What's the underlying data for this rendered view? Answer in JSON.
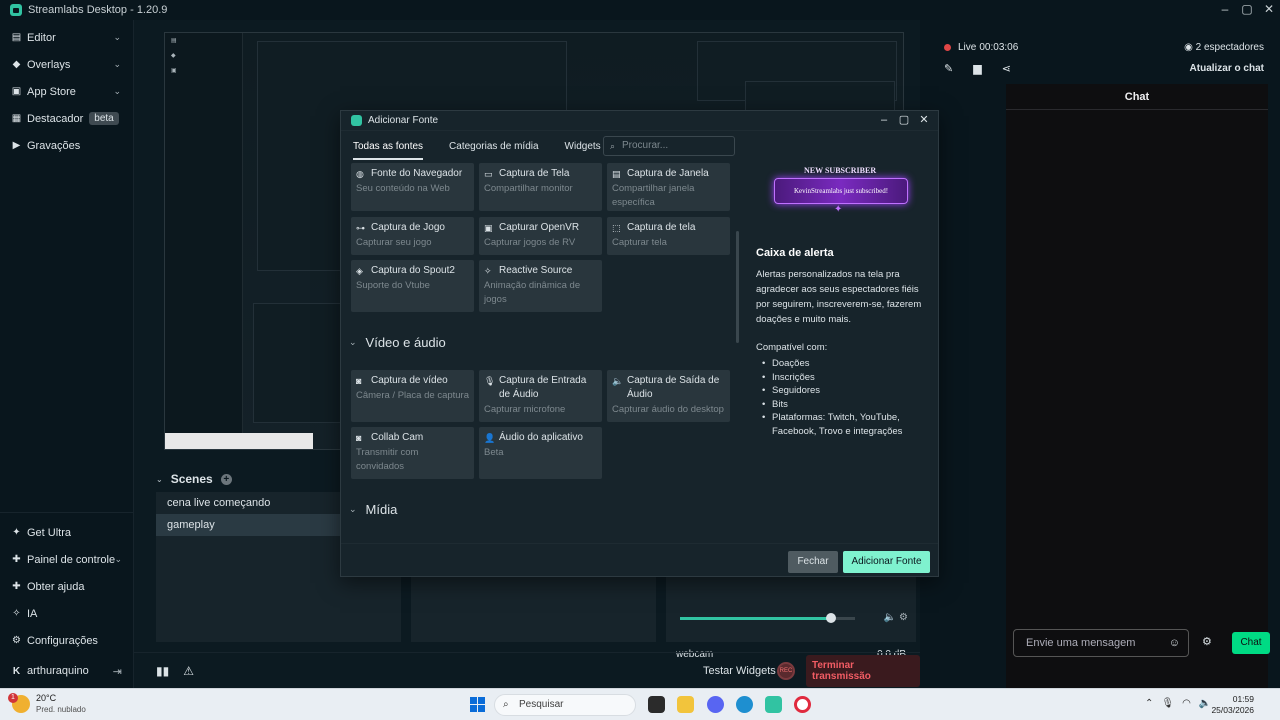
{
  "window": {
    "title": "Streamlabs Desktop - 1.20.9",
    "controls": [
      "–",
      "▢",
      "✕"
    ]
  },
  "sidebar": {
    "items": [
      {
        "label": "Editor",
        "icon": "editor-icon"
      },
      {
        "label": "Overlays",
        "icon": "overlays-icon"
      },
      {
        "label": "App Store",
        "icon": "app-store-icon"
      },
      {
        "label": "Destacador",
        "icon": "highlighter-icon",
        "badge": "beta"
      },
      {
        "label": "Gravações",
        "icon": "recordings-icon"
      }
    ],
    "bottom_items": [
      {
        "label": "Get Ultra",
        "icon": "ultra-icon"
      },
      {
        "label": "Painel de controle",
        "icon": "dashboard-icon"
      },
      {
        "label": "Obter ajuda",
        "icon": "help-icon"
      },
      {
        "label": "IA",
        "icon": "ai-sparkle-icon"
      },
      {
        "label": "Configurações",
        "icon": "settings-icon"
      }
    ],
    "user": "arthuraquino"
  },
  "scenes": {
    "title": "Scenes",
    "items": [
      "cena live começando",
      "gameplay"
    ],
    "active_index": 1
  },
  "mixer": {
    "source_name": "webcam",
    "level_db": "0.0 dB",
    "volume_fraction": 0.86
  },
  "footer": {
    "test_widgets": "Testar Widgets",
    "rec_label": "REC",
    "end_stream": "Terminar transmissão"
  },
  "right_panel": {
    "live_label": "Live",
    "live_time": "00:03:06",
    "viewers": "2 espectadores",
    "refresh_chat": "Atualizar o chat",
    "chat_title": "Chat",
    "chat_placeholder": "Envie uma mensagem",
    "chat_button": "Chat"
  },
  "modal": {
    "title": "Adicionar Fonte",
    "tabs": [
      "Todas as fontes",
      "Categorias de mídia",
      "Widgets"
    ],
    "search_placeholder": "Procurar...",
    "tiles_general": [
      {
        "name": "Fonte do Navegador",
        "desc": "Seu conteúdo na Web",
        "icon": "globe-icon"
      },
      {
        "name": "Captura de Tela",
        "desc": "Compartilhar monitor",
        "icon": "monitor-icon"
      },
      {
        "name": "Captura de Janela",
        "desc": "Compartilhar janela específica",
        "icon": "window-icon"
      },
      {
        "name": "Captura de Jogo",
        "desc": "Capturar seu jogo",
        "icon": "gamepad-icon"
      },
      {
        "name": "Capturar OpenVR",
        "desc": "Capturar jogos de RV",
        "icon": "vr-icon"
      },
      {
        "name": "Captura de tela",
        "desc": "Capturar tela",
        "icon": "screen-region-icon"
      },
      {
        "name": "Captura do Spout2",
        "desc": "Suporte do Vtube",
        "icon": "spout-icon"
      },
      {
        "name": "Reactive Source",
        "desc": "Animação dinâmica de jogos",
        "icon": "sparkle-icon"
      }
    ],
    "section_video": "Vídeo e áudio",
    "tiles_video": [
      {
        "name": "Captura de vídeo",
        "desc": "Câmera / Placa de captura",
        "icon": "camera-icon"
      },
      {
        "name": "Captura de Entrada de Áudio",
        "desc": "Capturar microfone",
        "icon": "mic-icon"
      },
      {
        "name": "Captura de Saída de Áudio",
        "desc": "Capturar áudio do desktop",
        "icon": "speaker-icon"
      },
      {
        "name": "Collab Cam",
        "desc": "Transmitir com convidados",
        "icon": "collab-icon"
      },
      {
        "name": "Áudio do aplicativo",
        "desc": "Beta",
        "icon": "app-audio-icon"
      }
    ],
    "section_media": "Mídia",
    "detail": {
      "banner_top": "NEW SUBSCRIBER",
      "banner_text": "KevinStreamlabs just subscribed!",
      "title": "Caixa de alerta",
      "description": "Alertas personalizados na tela pra agradecer aos seus espectadores fiéis por seguirem, inscreverem-se, fazerem doações e muito mais.",
      "compat_label": "Compatível com:",
      "compat_items": [
        "Doações",
        "Inscrições",
        "Seguidores",
        "Bits",
        "Plataformas: Twitch, YouTube, Facebook, Trovo e integrações"
      ]
    },
    "close_button": "Fechar",
    "add_button": "Adicionar Fonte"
  },
  "taskbar": {
    "weather_temp": "20°C",
    "weather_cond": "Pred. nublado",
    "weather_badge": "1",
    "search": "Pesquisar",
    "time": "01:59",
    "date": "25/03/2026"
  },
  "colors": {
    "accent": "#31c3a2",
    "chat_button": "#00db84",
    "danger": "#f25c64",
    "add_button": "#7ff2cf"
  }
}
